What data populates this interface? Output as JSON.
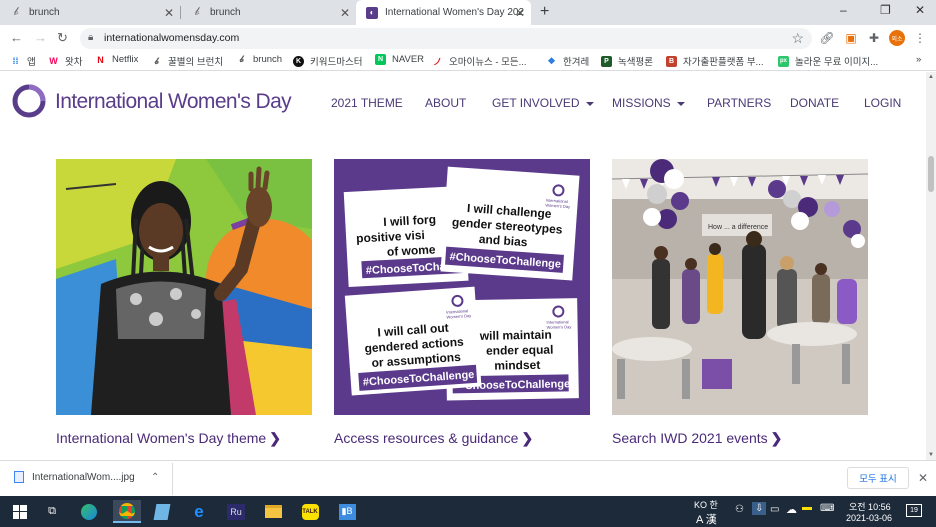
{
  "browser": {
    "tabs": [
      {
        "title": "brunch",
        "icon": "brunch-icon",
        "close": "✕"
      },
      {
        "title": "brunch",
        "icon": "brunch-icon",
        "close": "✕"
      },
      {
        "title": "International Women's Day 202",
        "icon": "iwd-icon",
        "close": "✕",
        "active": true
      }
    ],
    "new_tab": "+",
    "window_controls": [
      "–",
      "❐",
      "✕"
    ],
    "url": "internationalwomensday.com",
    "profile_label": "외소",
    "bookmarks": [
      {
        "label": "앱",
        "icon": "apps-grid-icon"
      },
      {
        "label": "왓차",
        "icon": "watcha-icon"
      },
      {
        "label": "Netflix",
        "icon": "netflix-icon"
      },
      {
        "label": "꿀별의 브런치",
        "icon": "brunch-icon"
      },
      {
        "label": "brunch",
        "icon": "brunch-icon"
      },
      {
        "label": "키워드마스터",
        "icon": "keyword-master-icon"
      },
      {
        "label": "NAVER",
        "icon": "naver-icon"
      },
      {
        "label": "오마이뉴스 - 모든...",
        "icon": "ohmynews-icon"
      },
      {
        "label": "한겨레",
        "icon": "hani-icon"
      },
      {
        "label": "녹색평론",
        "icon": "greenreview-icon"
      },
      {
        "label": "자가출판플랫폼 부...",
        "icon": "bookk-icon"
      },
      {
        "label": "놀라운 무료 이미지...",
        "icon": "pixabay-icon"
      }
    ],
    "bookmarks_more": "»"
  },
  "site": {
    "logo_text": "International Women's Day",
    "nav": [
      {
        "label": "2021 THEME",
        "dropdown": false
      },
      {
        "label": "ABOUT",
        "dropdown": false
      },
      {
        "label": "GET INVOLVED",
        "dropdown": true
      },
      {
        "label": "MISSIONS",
        "dropdown": true
      },
      {
        "label": "PARTNERS",
        "dropdown": false
      },
      {
        "label": "DONATE",
        "dropdown": false
      },
      {
        "label": "LOGIN",
        "dropdown": false
      }
    ],
    "cards": [
      {
        "link": "International Women's Day theme",
        "image": "woman-raising-hand-photo"
      },
      {
        "link": "Access resources & guidance",
        "image": "choose-to-challenge-cards"
      },
      {
        "link": "Search IWD 2021 events",
        "image": "event-hall-balloons-photo"
      }
    ],
    "chevron": "❯",
    "resource_cards": [
      {
        "text": "I will forge positive visi of wome",
        "tag": "#ChooseToChall"
      },
      {
        "text": "I will challenge gender stereotypes and bias",
        "tag": "#ChooseToChallenge"
      },
      {
        "text": "I will call out gendered actions or assumptions",
        "tag": "#ChooseToChallenge"
      },
      {
        "text": "will maintain ender equal mindset",
        "tag": "ChooseToChallenge"
      }
    ],
    "mini_logo": "International Women's Day"
  },
  "downloads": {
    "file": "InternationalWom....jpg",
    "show_all": "모두 표시",
    "close": "✕"
  },
  "taskbar": {
    "ime_top": "KO 한",
    "ime_bottom": "A 漢",
    "time": "오전 10:56",
    "date": "2021-03-06",
    "notification_count": "19"
  },
  "colors": {
    "brand_purple": "#5a3d8a",
    "link_purple": "#4a2a78",
    "card_bg_purple": "#5b3a8c",
    "profile_orange": "#e8710a"
  }
}
